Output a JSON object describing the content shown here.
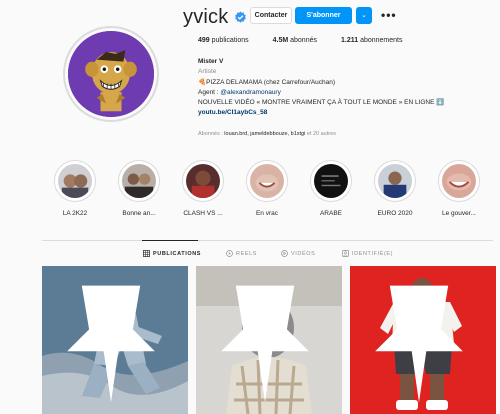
{
  "profile": {
    "username": "yvick",
    "contact_label": "Contacter",
    "follow_label": "S'abonner",
    "dropdown_glyph": "⌄",
    "more_glyph": "•••"
  },
  "stats": {
    "posts_count": "499",
    "posts_label": "publications",
    "followers_count": "4.5M",
    "followers_label": "abonnés",
    "following_count": "1.211",
    "following_label": "abonnements"
  },
  "bio": {
    "name": "Mister V",
    "category": "Artiste",
    "line1": "🍕PIZZA DELAMAMA (chez Carrefour/Auchan)",
    "agent_prefix": "Agent : ",
    "agent_mention": "@alexandramonaury",
    "line3": "NOUVELLE VIDÉO « MONTRE VRAIMENT ÇA À TOUT LE MONDE » EN LIGNE ⬇️",
    "link": "youtu.be/CI1aybCs_58"
  },
  "followed_by": {
    "prefix": "Abonnés : ",
    "names": "louan.brd, jameldebbouze, b1stgi",
    "suffix": " et 20 autres"
  },
  "highlights": [
    {
      "label": "LA 2K22"
    },
    {
      "label": "Bonne an..."
    },
    {
      "label": "CLASH VS ..."
    },
    {
      "label": "En vrac"
    },
    {
      "label": "ARABE"
    },
    {
      "label": "EURO 2020"
    },
    {
      "label": "Le gouver..."
    }
  ],
  "tabs": [
    {
      "label": "PUBLICATIONS",
      "icon": "grid-icon"
    },
    {
      "label": "REELS",
      "icon": "reels-icon"
    },
    {
      "label": "VIDÉOS",
      "icon": "video-icon"
    },
    {
      "label": "IDENTIFIÉ(E)",
      "icon": "tag-icon"
    }
  ],
  "colors": {
    "accent": "#0095f6",
    "verified": "#3897f0",
    "background": "#fafafa",
    "link": "#00376b"
  }
}
